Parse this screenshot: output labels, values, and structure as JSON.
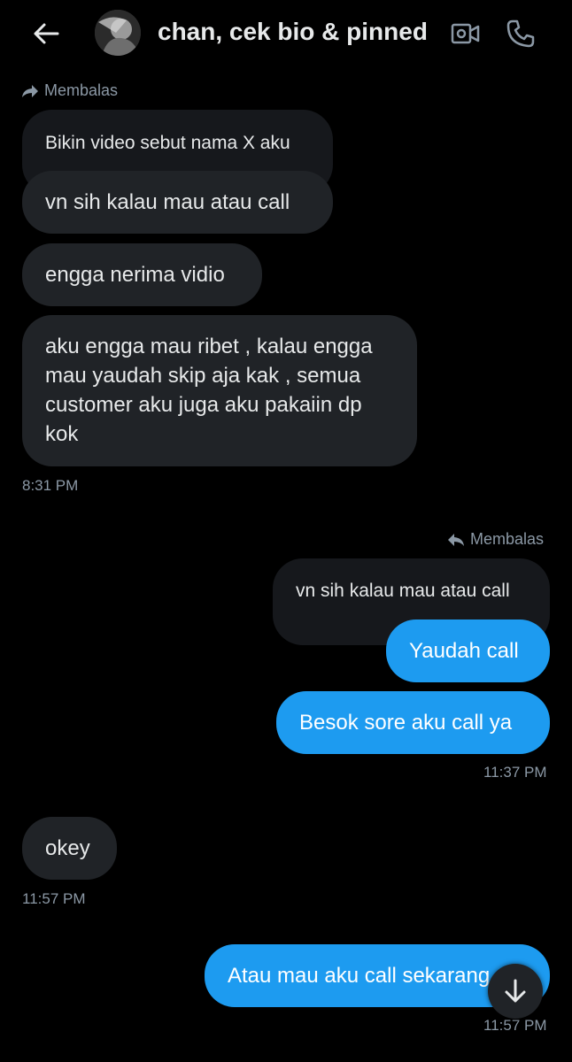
{
  "header": {
    "title": "chan, cek bio & pinned",
    "back_icon": "arrow-left-icon",
    "video_icon": "video-call-icon",
    "call_icon": "phone-icon"
  },
  "messages": {
    "reply_label_in": "Membalas",
    "quote_in": "Bikin video sebut nama X aku",
    "in_1": "vn sih kalau mau atau call",
    "in_2": "engga nerima vidio",
    "in_3": "aku engga mau ribet , kalau engga mau yaudah skip aja kak , semua customer aku juga aku pakaiin dp kok",
    "time_1": "8:31 PM",
    "reply_label_out": "Membalas",
    "quote_out": "vn sih kalau mau atau call",
    "out_1": "Yaudah call",
    "out_2": "Besok sore aku call ya",
    "time_2": "11:37 PM",
    "in_4": "okey",
    "time_3": "11:57 PM",
    "out_3": "Atau mau aku call sekarang",
    "time_4": "11:57 PM"
  },
  "scroll_button_icon": "arrow-down-icon",
  "colors": {
    "background": "#000000",
    "incoming_bubble": "#202327",
    "outgoing_bubble": "#1d9bf0",
    "muted_text": "#8b98a5"
  }
}
